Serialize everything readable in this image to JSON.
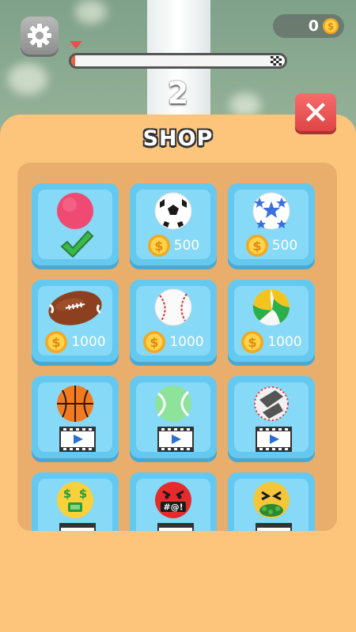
{
  "hud": {
    "coins": "0",
    "level": "2",
    "progress_fraction": 0.02
  },
  "shop": {
    "title": "SHOP",
    "items": [
      {
        "name": "pink-ball",
        "status": "selected"
      },
      {
        "name": "soccer-ball",
        "price": "500"
      },
      {
        "name": "star-ball",
        "price": "500"
      },
      {
        "name": "american-football",
        "price": "1000"
      },
      {
        "name": "baseball",
        "price": "1000"
      },
      {
        "name": "volleyball",
        "price": "1000"
      },
      {
        "name": "basketball",
        "unlock": "video"
      },
      {
        "name": "tennis-ball",
        "unlock": "video"
      },
      {
        "name": "spiked-ball",
        "unlock": "video"
      },
      {
        "name": "money-emoji-ball",
        "unlock": "video"
      },
      {
        "name": "angry-emoji-ball",
        "unlock": "video",
        "text": "#@!"
      },
      {
        "name": "sick-emoji-ball",
        "unlock": "video"
      }
    ]
  },
  "colors": {
    "panel": "#fdc57c",
    "grid": "#e9ae6c",
    "card": "#65c8ef",
    "close": "#e94e4e",
    "coin": "#f7b62c",
    "check": "#3bb84a"
  }
}
